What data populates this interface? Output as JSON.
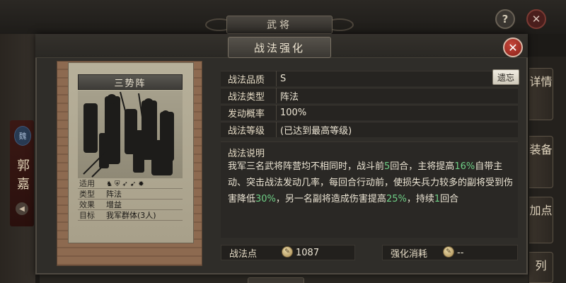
{
  "background": {
    "title": "武将",
    "hero_name": "郭嘉",
    "side_tabs": [
      "详情",
      "装备",
      "加点",
      "列"
    ],
    "help_label": "?",
    "close_label": "✕"
  },
  "dialog": {
    "title": "战法强化",
    "close_label": "✕"
  },
  "card": {
    "name": "三势阵",
    "info": [
      {
        "key": "适用",
        "value": ""
      },
      {
        "key": "类型",
        "value": "阵法"
      },
      {
        "key": "效果",
        "value": "增益"
      },
      {
        "key": "目标",
        "value": "我军群体(3人)"
      }
    ],
    "troop_icons": [
      "cavalry-icon",
      "shield-icon",
      "bow-icon",
      "spear-icon",
      "siege-icon"
    ]
  },
  "properties": [
    {
      "key": "战法品质",
      "value": "S"
    },
    {
      "key": "战法类型",
      "value": "阵法"
    },
    {
      "key": "发动概率",
      "value": "100%"
    },
    {
      "key": "战法等级",
      "value": "(已达到最高等级)"
    }
  ],
  "inherit_button": "遗忘",
  "description": {
    "title": "战法说明",
    "parts": [
      {
        "text": "我军三名武将阵营均不相同时，战斗前",
        "highlight": false
      },
      {
        "text": "5",
        "highlight": true
      },
      {
        "text": "回合，主将提高",
        "highlight": false
      },
      {
        "text": "16%",
        "highlight": true
      },
      {
        "text": "自带主动、突击战法发动几率，每回合行动前，使损失兵力较多的副将受到伤害降低",
        "highlight": false
      },
      {
        "text": "30%",
        "highlight": true
      },
      {
        "text": "，另一名副将造成伤害提高",
        "highlight": false
      },
      {
        "text": "25%",
        "highlight": true
      },
      {
        "text": "，持续",
        "highlight": false
      },
      {
        "text": "1",
        "highlight": true
      },
      {
        "text": "回合",
        "highlight": false
      }
    ]
  },
  "footer": {
    "points_label": "战法点",
    "points_value": "1087",
    "cost_label": "强化消耗",
    "cost_value": "--"
  },
  "colors": {
    "highlight": "#6fcf86",
    "close_red": "#c5463a"
  }
}
